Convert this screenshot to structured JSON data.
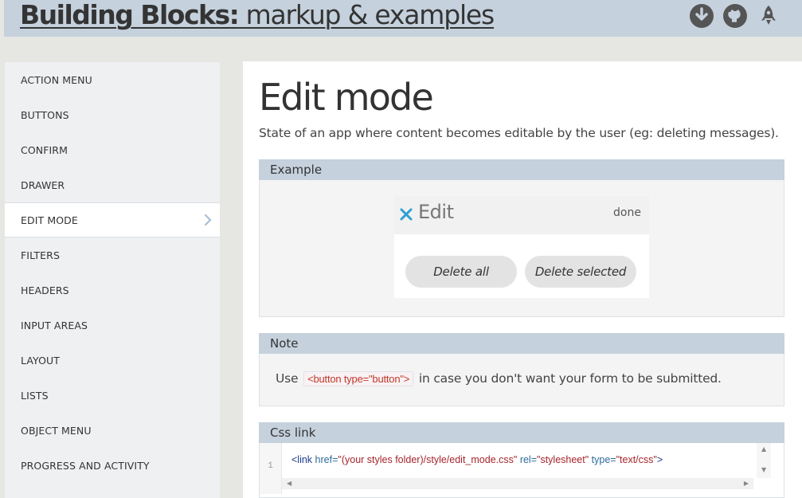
{
  "header": {
    "title_strong": "Building Blocks:",
    "title_light": "markup & examples",
    "icons": [
      "download-icon",
      "github-icon",
      "rocket-icon"
    ]
  },
  "sidebar": {
    "items": [
      {
        "label": "ACTION MENU"
      },
      {
        "label": "BUTTONS"
      },
      {
        "label": "CONFIRM"
      },
      {
        "label": "DRAWER"
      },
      {
        "label": "EDIT MODE",
        "active": true
      },
      {
        "label": "FILTERS"
      },
      {
        "label": "HEADERS"
      },
      {
        "label": "INPUT AREAS"
      },
      {
        "label": "LAYOUT"
      },
      {
        "label": "LISTS"
      },
      {
        "label": "OBJECT MENU"
      },
      {
        "label": "PROGRESS AND ACTIVITY"
      }
    ]
  },
  "main": {
    "title": "Edit mode",
    "description": "State of an app where content becomes editable by the user (eg: deleting messages).",
    "example": {
      "heading": "Example",
      "widget_title": "Edit",
      "done_label": "done",
      "btn_delete_all": "Delete all",
      "btn_delete_selected": "Delete selected"
    },
    "note": {
      "heading": "Note",
      "prefix": "Use",
      "code": "<button type=\"button\">",
      "suffix": "in case you don't want your form to be submitted."
    },
    "css_link": {
      "heading": "Css link",
      "line_number": "1",
      "tag_open": "<link",
      "attr_href": "href=",
      "val_href": "\"(your styles folder)/style/edit_mode.css\"",
      "attr_rel": "rel=",
      "val_rel": "\"stylesheet\"",
      "attr_type": "type=",
      "val_type": "\"text/css\"",
      "tag_close": ">"
    }
  },
  "colors": {
    "header_bg": "#c5d1dd",
    "section_head_bg": "#c5d1dd",
    "close_x": "#2e9fd4",
    "code_inline": "#c0392b"
  }
}
